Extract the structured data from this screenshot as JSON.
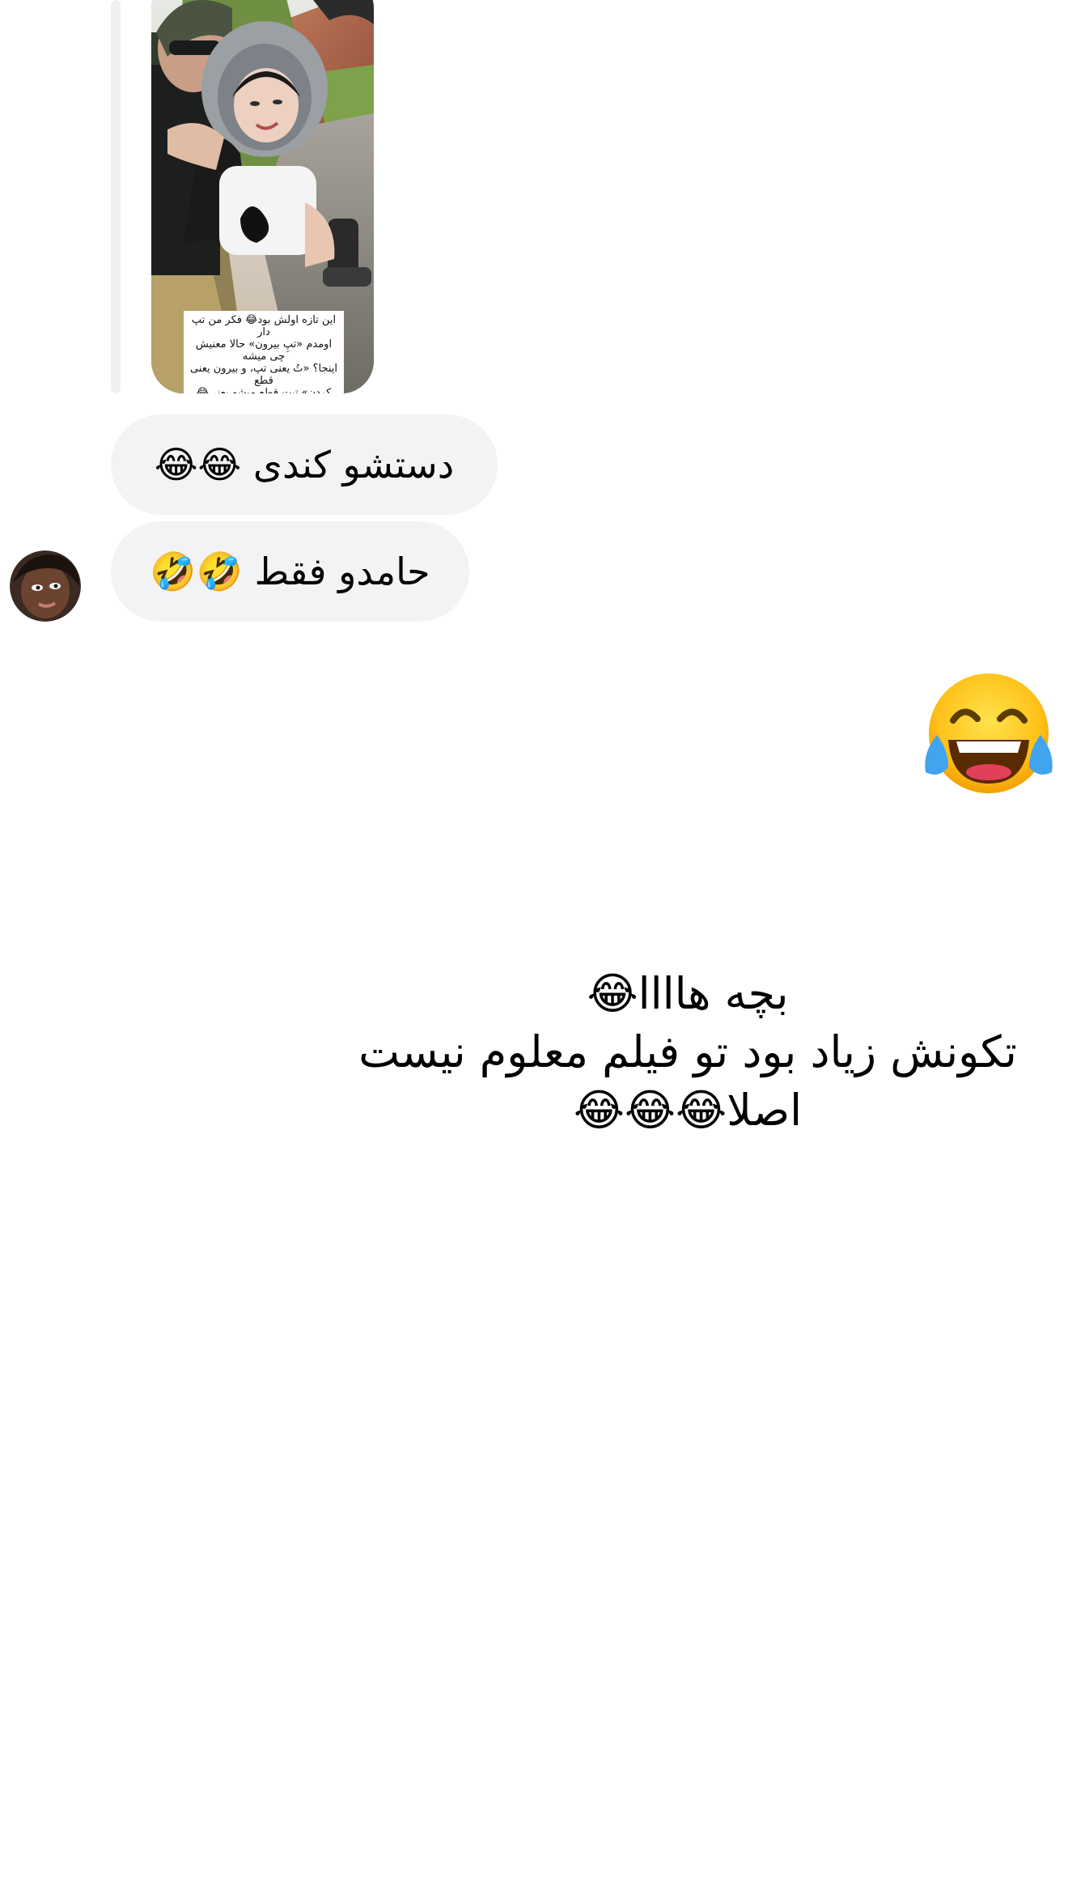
{
  "thread": {
    "shared_reel": {
      "caption": "این تازه اولش بود😂 فکر من تپ دار\nاومدم «تپِ بیرون» حالا معنیش چی میشه\nاینجا؟ «تُ یعنی تپ، و بیرون یعنی قطع\nکردن» تپت قطع میشه یعنی😂"
    },
    "received_messages": [
      {
        "text": "دستشو کندی 😂😂"
      },
      {
        "text": "حامدو فقط 🤣🤣"
      }
    ],
    "reaction_emoji": "😂",
    "sent_message": {
      "line1": "بچه هاااا😂",
      "line2": "تکونش زیاد بود تو فیلم معلوم نیست",
      "line3": "اصلا😂😂😂"
    }
  },
  "colors": {
    "bubble_background": "#f2f3f5",
    "reply_line": "#eef0f2",
    "text": "#000000",
    "page_background": "#ffffff"
  },
  "icons": {
    "avatar": "sender-avatar",
    "big_reaction": "face-with-tears-of-joy-icon"
  }
}
